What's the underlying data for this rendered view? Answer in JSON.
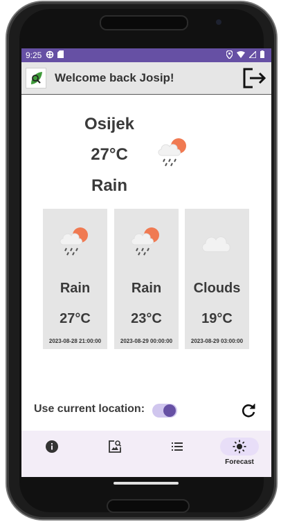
{
  "status_bar": {
    "time": "9:25"
  },
  "app_bar": {
    "welcome": "Welcome back Josip!"
  },
  "current": {
    "city": "Osijek",
    "temperature": "27°C",
    "condition": "Rain",
    "icon": "rain-cloud-sun-icon"
  },
  "forecast": [
    {
      "condition": "Rain",
      "temperature": "27°C",
      "datetime": "2023-08-28 21:00:00",
      "icon": "rain-cloud-sun-icon"
    },
    {
      "condition": "Rain",
      "temperature": "23°C",
      "datetime": "2023-08-29 00:00:00",
      "icon": "rain-cloud-sun-icon"
    },
    {
      "condition": "Clouds",
      "temperature": "19°C",
      "datetime": "2023-08-29 03:00:00",
      "icon": "cloud-icon"
    }
  ],
  "location": {
    "label": "Use current location:",
    "enabled": true
  },
  "bottom_nav": {
    "items": [
      {
        "icon": "info-icon",
        "label": ""
      },
      {
        "icon": "image-search-icon",
        "label": ""
      },
      {
        "icon": "list-icon",
        "label": ""
      },
      {
        "icon": "sun-icon",
        "label": "Forecast",
        "active": true
      }
    ]
  },
  "colors": {
    "accent": "#6650a4",
    "nav_background": "#f3edf7",
    "card_background": "#e5e5e5"
  }
}
